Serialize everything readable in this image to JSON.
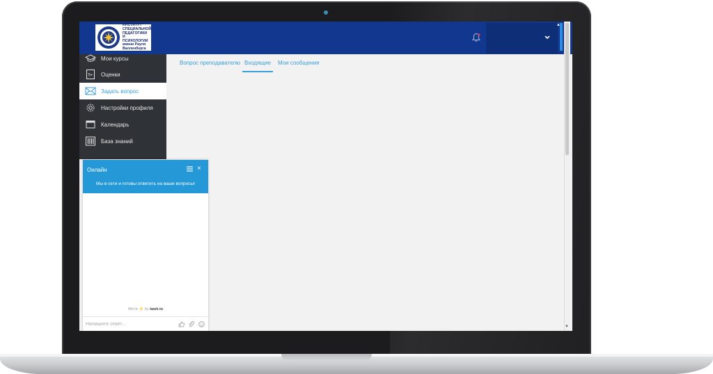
{
  "logo": {
    "text": "ИНСТИТУТ\nСПЕЦИАЛЬНОЙ\nПЕДАГОГИКИ\nИ ПСИХОЛОГИИ\nимени Рауля Валленберга",
    "emblem_icon": "sun-emblem-icon"
  },
  "header": {
    "notification_icon": "bell-icon",
    "dropdown_icon": "chevron-down-icon",
    "accent_color": "#12378f"
  },
  "sidebar": {
    "items": [
      {
        "label": "Мои курсы",
        "icon": "graduation-cap-icon"
      },
      {
        "label": "Оценки",
        "icon": "grade-5plus-icon"
      },
      {
        "label": "Задать вопрос",
        "icon": "envelope-icon",
        "active": true
      },
      {
        "label": "Настройки профиля",
        "icon": "gear-icon"
      },
      {
        "label": "Календарь",
        "icon": "calendar-icon"
      },
      {
        "label": "База знаний",
        "icon": "library-icon"
      }
    ]
  },
  "tabs": [
    {
      "label": "Вопрос преподавателю"
    },
    {
      "label": "Входящие",
      "active": true
    },
    {
      "label": "Мои сообщения"
    }
  ],
  "chat": {
    "title": "Онлайн",
    "message": "Мы в сети и готовы ответить на ваши вопросы!",
    "powered_prefix": "We're",
    "powered_by": "by",
    "powered_brand": "tawk.to",
    "input_placeholder": "Напишите ответ...",
    "color": "#2598d8"
  }
}
